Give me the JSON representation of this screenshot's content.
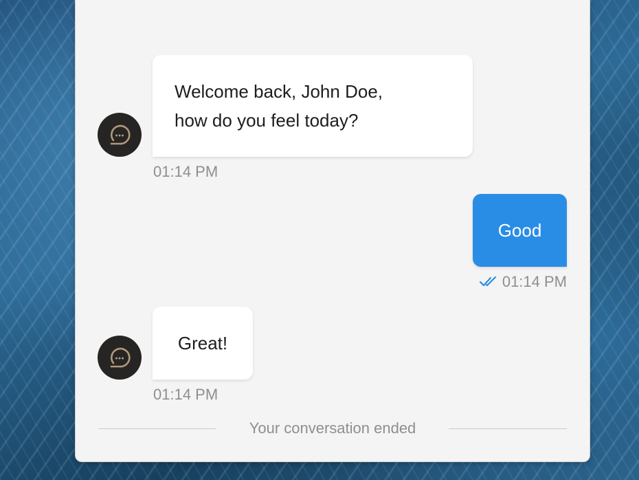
{
  "messages": [
    {
      "sender": "bot",
      "lines": [
        "Welcome back, John Doe,",
        "how do you feel today?"
      ],
      "time": "01:14 PM"
    },
    {
      "sender": "user",
      "text": "Good",
      "time": "01:14 PM",
      "read_icon": "double-check-icon"
    },
    {
      "sender": "bot",
      "text": "Great!",
      "time": "01:14 PM"
    }
  ],
  "bot_avatar_icon": "chat-bubble-icon",
  "conversation_status": "Your conversation ended",
  "colors": {
    "user_bubble": "#2a8de5",
    "bot_bubble": "#ffffff",
    "avatar_bg": "#262523",
    "avatar_icon": "#b09a7b",
    "read_check": "#2a8de5",
    "timestamp": "#8e8e93"
  }
}
